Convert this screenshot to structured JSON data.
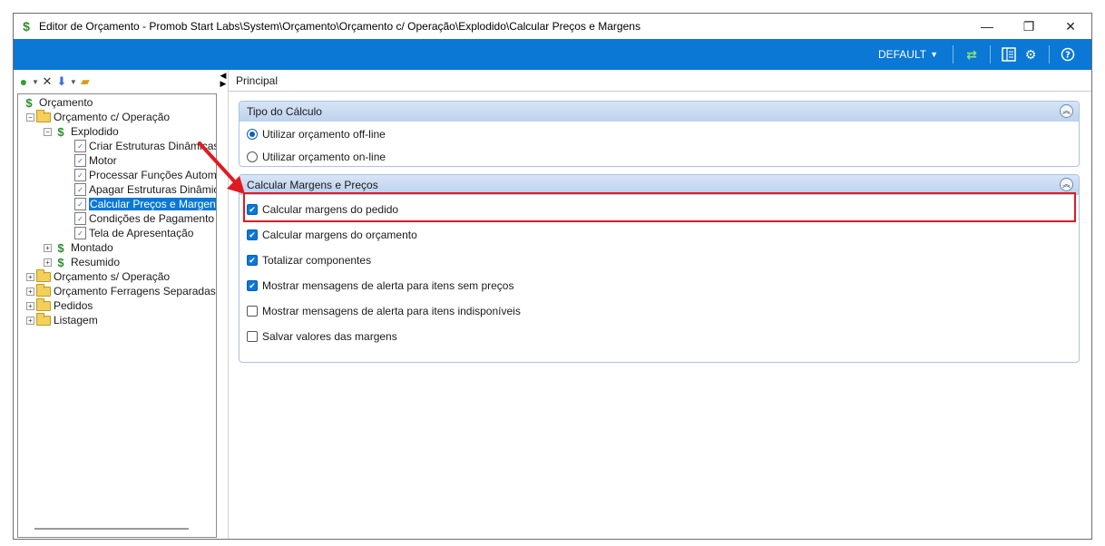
{
  "window": {
    "title": "Editor de Orçamento - Promob Start Labs\\System\\Orçamento\\Orçamento c/ Operação\\Explodido\\Calcular Preços e Margens",
    "controls": {
      "minimize": "—",
      "restore": "❐",
      "close": "✕"
    }
  },
  "toolbar": {
    "profile_label": "DEFAULT",
    "icons": [
      "refresh-icon",
      "layout-icon",
      "settings-icon",
      "help-icon"
    ]
  },
  "left_toolbar": {
    "icons": [
      "go-icon",
      "delete-icon",
      "move-icon",
      "open-folder-icon"
    ]
  },
  "tree": {
    "nodes": [
      {
        "label": "Orçamento",
        "icon": "money-icon"
      },
      {
        "label": "Orçamento c/ Operação",
        "icon": "folder-icon",
        "expander": "−"
      },
      {
        "label": "Explodido",
        "icon": "money-icon",
        "expander": "−"
      },
      {
        "label": "Criar Estruturas Dinâmicas",
        "icon": "doc-icon"
      },
      {
        "label": "Motor",
        "icon": "doc-icon"
      },
      {
        "label": "Processar Funções Automáticas",
        "icon": "doc-icon"
      },
      {
        "label": "Apagar Estruturas Dinâmicas",
        "icon": "doc-icon"
      },
      {
        "label": "Calcular Preços e Margens",
        "icon": "doc-icon",
        "selected": true
      },
      {
        "label": "Condições de Pagamento",
        "icon": "doc-icon"
      },
      {
        "label": "Tela de Apresentação",
        "icon": "doc-icon"
      },
      {
        "label": "Montado",
        "icon": "money-icon",
        "expander": "+"
      },
      {
        "label": "Resumido",
        "icon": "money-icon",
        "expander": "+"
      },
      {
        "label": "Orçamento s/ Operação",
        "icon": "folder-icon",
        "expander": "+"
      },
      {
        "label": "Orçamento Ferragens Separadas",
        "icon": "folder-icon",
        "expander": "+"
      },
      {
        "label": "Pedidos",
        "icon": "folder-icon",
        "expander": "+"
      },
      {
        "label": "Listagem",
        "icon": "folder-icon",
        "expander": "+"
      }
    ]
  },
  "main": {
    "tab_label": "Principal",
    "calc_type": {
      "title": "Tipo do Cálculo",
      "options": [
        {
          "label": "Utilizar orçamento off-line",
          "selected": true
        },
        {
          "label": "Utilizar orçamento on-line",
          "selected": false
        }
      ]
    },
    "margins": {
      "title": "Calcular Margens e Preços",
      "options": [
        {
          "label": "Calcular margens do pedido",
          "checked": true
        },
        {
          "label": "Calcular margens do orçamento",
          "checked": true
        },
        {
          "label": "Totalizar componentes",
          "checked": true
        },
        {
          "label": "Mostrar mensagens de alerta para itens sem preços",
          "checked": true
        },
        {
          "label": "Mostrar mensagens de alerta para itens indisponíveis",
          "checked": false
        },
        {
          "label": "Salvar valores das margens",
          "checked": false
        }
      ]
    }
  },
  "colors": {
    "accent": "#0a78d4",
    "highlight": "#e01a22",
    "group_header": "#c7d9f0"
  }
}
